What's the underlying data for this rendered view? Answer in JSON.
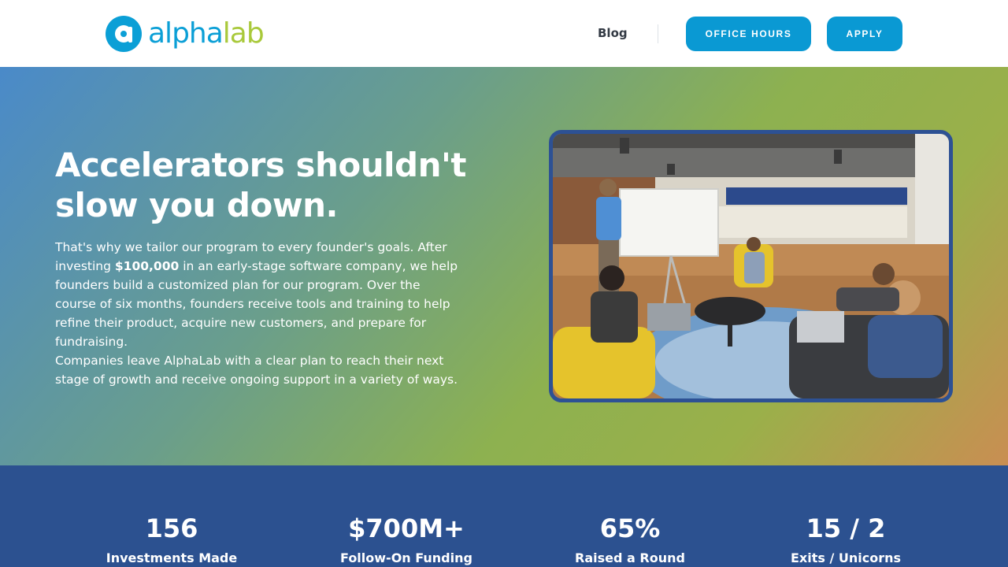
{
  "header": {
    "logo_alpha": "alpha",
    "logo_lab": "lab",
    "blog_label": "Blog",
    "office_hours_label": "OFFICE HOURS",
    "apply_label": "APPLY"
  },
  "hero": {
    "title": "Accelerators shouldn't slow you down.",
    "p1_before": "That's why we tailor our program to every founder's goals. After investing ",
    "p1_bold": "$100,000",
    "p1_after": " in an early-stage software company, we help founders build a customized plan for our program. Over the course of six months, founders receive tools and training to help refine their product, acquire new customers, and prepare for fundraising.",
    "p2": "Companies leave AlphaLab with a clear plan to reach their next stage of growth and receive ongoing support in a variety of ways."
  },
  "stats": [
    {
      "value": "156",
      "label": "Investments Made"
    },
    {
      "value": "$700M+",
      "label": "Follow-On Funding"
    },
    {
      "value": "65%",
      "label": "Raised a Round"
    },
    {
      "value": "15 / 2",
      "label": "Exits / Unicorns"
    }
  ],
  "colors": {
    "brand_blue": "#0b9fd6",
    "brand_green": "#a9c93b",
    "stats_bg": "#2c5190"
  }
}
